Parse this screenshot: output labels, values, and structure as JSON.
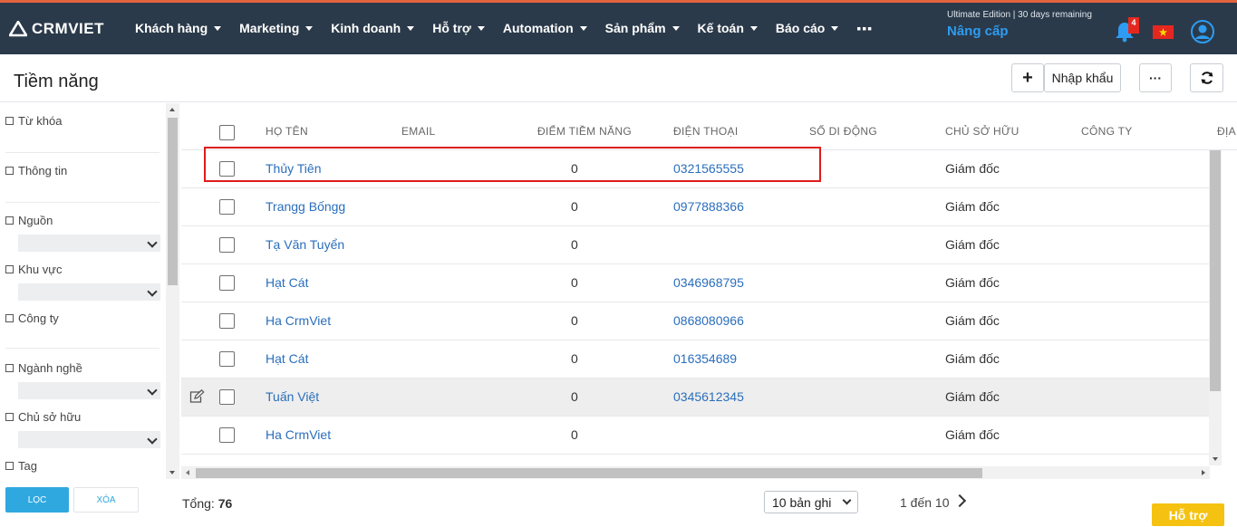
{
  "app": {
    "logo_text": "CRMVIET"
  },
  "nav": {
    "items": [
      {
        "label": "Khách hàng"
      },
      {
        "label": "Marketing"
      },
      {
        "label": "Kinh doanh"
      },
      {
        "label": "Hỗ trợ"
      },
      {
        "label": "Automation"
      },
      {
        "label": "Sản phẩm"
      },
      {
        "label": "Kế toán"
      },
      {
        "label": "Báo cáo"
      }
    ],
    "more": "▪▪▪"
  },
  "account": {
    "edition": "Ultimate Edition | 30 days remaining",
    "upgrade": "Nâng cấp",
    "notification_count": "4"
  },
  "page": {
    "title": "Tiềm năng",
    "add_label": "+",
    "import_label": "Nhập khẩu",
    "more_label": "···"
  },
  "filters": {
    "keyword": "Từ khóa",
    "info": "Thông tin",
    "source": "Nguồn",
    "region": "Khu vực",
    "company": "Công ty",
    "industry": "Ngành nghề",
    "owner": "Chủ sở hữu",
    "tag": "Tag",
    "filter_button": "LỌC",
    "clear_button": "XÓA"
  },
  "table": {
    "columns": [
      "HỌ TÊN",
      "EMAIL",
      "ĐIỂM TIỀM NĂNG",
      "ĐIỆN THOẠI",
      "SỐ DI ĐỘNG",
      "CHỦ SỞ HỮU",
      "CÔNG TY",
      "ĐỊA"
    ],
    "rows": [
      {
        "name": "Thủy Tiên",
        "score": "0",
        "phone": "0321565555",
        "owner": "Giám đốc"
      },
      {
        "name": "Trangg Bốngg",
        "score": "0",
        "phone": "0977888366",
        "owner": "Giám đốc"
      },
      {
        "name": "Tạ Văn Tuyển",
        "score": "0",
        "phone": "",
        "owner": "Giám đốc"
      },
      {
        "name": "Hạt Cát",
        "score": "0",
        "phone": "0346968795",
        "owner": "Giám đốc"
      },
      {
        "name": "Ha CrmViet",
        "score": "0",
        "phone": "0868080966",
        "owner": "Giám đốc"
      },
      {
        "name": "Hạt Cát",
        "score": "0",
        "phone": "016354689",
        "owner": "Giám đốc"
      },
      {
        "name": "Tuấn Việt",
        "score": "0",
        "phone": "0345612345",
        "owner": "Giám đốc"
      },
      {
        "name": "Ha CrmViet",
        "score": "0",
        "phone": "",
        "owner": "Giám đốc"
      }
    ]
  },
  "footer": {
    "total_label": "Tổng:",
    "total_value": "76",
    "page_size": "10 bản ghi",
    "range": "1 đến 10",
    "support": "Hỗ trợ"
  },
  "colors": {
    "topbar": "#2b3a4a",
    "accent_line": "#e2643d",
    "link": "#2a6ebb",
    "upgrade": "#2d9cf2",
    "filter_button": "#2fa8e0",
    "support": "#f5c211",
    "highlight": "#e01b1b"
  }
}
